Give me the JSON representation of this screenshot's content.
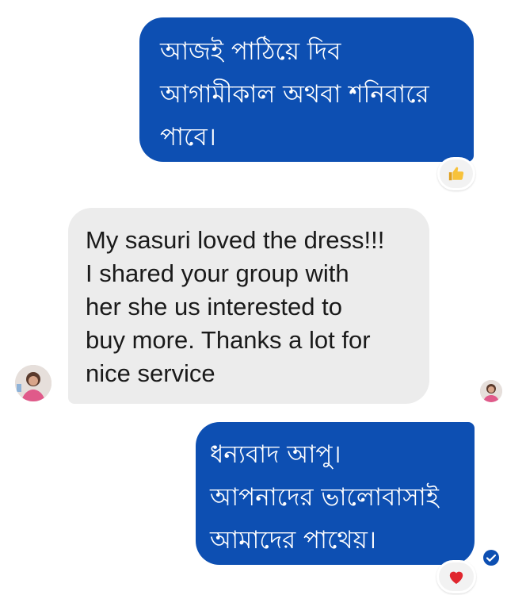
{
  "messages": [
    {
      "direction": "outgoing",
      "text": "আজই পাঠিয়ে দিব\nআগামীকাল অথবা শনিবারে\nপাবে।",
      "reaction": "thumbs-up-icon"
    },
    {
      "direction": "incoming",
      "text": "My sasuri loved the dress!!!\nI shared your group with\nher she us interested to\nbuy more. Thanks a lot for\nnice service"
    },
    {
      "direction": "outgoing",
      "text": "ধন্যবাদ আপু।\nআপনাদের ভালোবাসাই\nআমাদের পাথেয়।",
      "reaction": "heart-icon",
      "status_icon": "sent-check-icon"
    }
  ],
  "colors": {
    "outgoing_bubble": "#0d4fb2",
    "incoming_bubble": "#ececec",
    "background": "#ffffff"
  }
}
